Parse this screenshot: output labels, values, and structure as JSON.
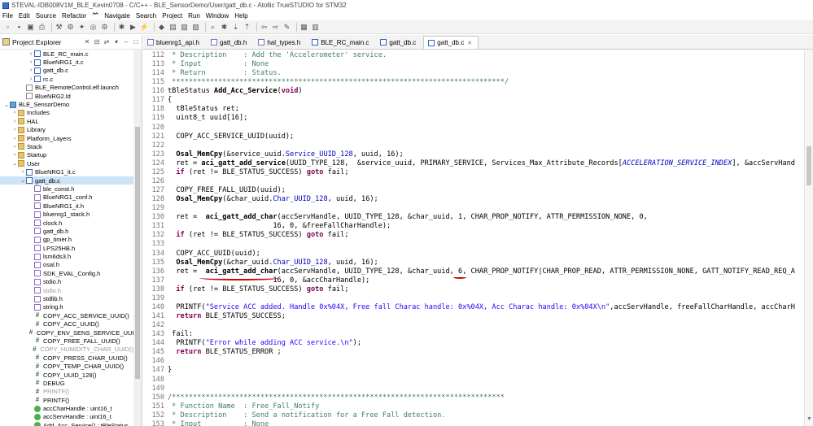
{
  "window": {
    "title": "STEVAL-IDB008V1M_BLE_Kevin0708 - C/C++ - BLE_SensorDemo/User/gatt_db.c - Atollic TrueSTUDIO for STM32"
  },
  "menu": [
    "File",
    "Edit",
    "Source",
    "Refactor",
    "𥫗",
    "Navigate",
    "Search",
    "Project",
    "Run",
    "Window",
    "Help"
  ],
  "toolbar": {
    "icons": [
      "new-icon",
      "save-icon",
      "save-all-icon",
      "print-icon",
      "build-icon",
      "build-all-icon",
      "clean-icon",
      "target-icon",
      "config-icon",
      "debug-icon",
      "run-icon",
      "external-tools-icon",
      "new-class-icon",
      "new-folder-icon",
      "new-source-icon",
      "new-header-icon",
      "search-icon",
      "bug-icon",
      "next-annotation-icon",
      "prev-annotation-icon",
      "back-icon",
      "forward-icon",
      "pin-icon",
      "perspective-icon",
      "layout-icon"
    ]
  },
  "explorer": {
    "title": "Project Explorer",
    "items": [
      {
        "label": "BLE_RC_main.c",
        "indent": 3,
        "arrow": ">",
        "icon": "cfile"
      },
      {
        "label": "BlueNRG1_it.c",
        "indent": 3,
        "arrow": ">",
        "icon": "cfile"
      },
      {
        "label": "gatt_db.c",
        "indent": 3,
        "arrow": ">",
        "icon": "cfile"
      },
      {
        "label": "rc.c",
        "indent": 3,
        "arrow": ">",
        "icon": "cfile"
      },
      {
        "label": "BLE_RemoteControl.elf.launch",
        "indent": 2,
        "arrow": "",
        "icon": "file"
      },
      {
        "label": "BlueNRG2.ld",
        "indent": 2,
        "arrow": "",
        "icon": "file"
      },
      {
        "label": "BLE_SensorDemo",
        "indent": 0,
        "arrow": "v",
        "icon": "project"
      },
      {
        "label": "Includes",
        "indent": 1,
        "arrow": ">",
        "icon": "folder"
      },
      {
        "label": "HAL",
        "indent": 1,
        "arrow": ">",
        "icon": "folder"
      },
      {
        "label": "Library",
        "indent": 1,
        "arrow": ">",
        "icon": "folder"
      },
      {
        "label": "Platform_Layers",
        "indent": 1,
        "arrow": ">",
        "icon": "folder"
      },
      {
        "label": "Stack",
        "indent": 1,
        "arrow": ">",
        "icon": "folder"
      },
      {
        "label": "Startup",
        "indent": 1,
        "arrow": ">",
        "icon": "folder"
      },
      {
        "label": "User",
        "indent": 1,
        "arrow": "v",
        "icon": "folder"
      },
      {
        "label": "BlueNRG1_it.c",
        "indent": 2,
        "arrow": ">",
        "icon": "cfile"
      },
      {
        "label": "gatt_db.c",
        "indent": 2,
        "arrow": "v",
        "icon": "cfile",
        "selected": true
      },
      {
        "label": "ble_const.h",
        "indent": 3,
        "arrow": "",
        "icon": "hfile"
      },
      {
        "label": "BlueNRG1_conf.h",
        "indent": 3,
        "arrow": "",
        "icon": "hfile"
      },
      {
        "label": "BlueNRG1_it.h",
        "indent": 3,
        "arrow": "",
        "icon": "hfile"
      },
      {
        "label": "bluenrg1_stack.h",
        "indent": 3,
        "arrow": "",
        "icon": "hfile"
      },
      {
        "label": "clock.h",
        "indent": 3,
        "arrow": "",
        "icon": "hfile"
      },
      {
        "label": "gatt_db.h",
        "indent": 3,
        "arrow": "",
        "icon": "hfile"
      },
      {
        "label": "gp_timer.h",
        "indent": 3,
        "arrow": "",
        "icon": "hfile"
      },
      {
        "label": "LPS25HB.h",
        "indent": 3,
        "arrow": "",
        "icon": "hfile"
      },
      {
        "label": "lsm6ds3.h",
        "indent": 3,
        "arrow": "",
        "icon": "hfile"
      },
      {
        "label": "osal.h",
        "indent": 3,
        "arrow": "",
        "icon": "hfile"
      },
      {
        "label": "SDK_EVAL_Config.h",
        "indent": 3,
        "arrow": "",
        "icon": "hfile"
      },
      {
        "label": "stdio.h",
        "indent": 3,
        "arrow": "",
        "icon": "hfile"
      },
      {
        "label": "stdio.h",
        "indent": 3,
        "arrow": "",
        "icon": "hfile",
        "gray": true
      },
      {
        "label": "stdlib.h",
        "indent": 3,
        "arrow": "",
        "icon": "hfile"
      },
      {
        "label": "string.h",
        "indent": 3,
        "arrow": "",
        "icon": "hfile"
      },
      {
        "label": "COPY_ACC_SERVICE_UUID()",
        "indent": 3,
        "arrow": "",
        "icon": "hash"
      },
      {
        "label": "COPY_ACC_UUID()",
        "indent": 3,
        "arrow": "",
        "icon": "hash"
      },
      {
        "label": "COPY_ENV_SENS_SERVICE_UUID()",
        "indent": 3,
        "arrow": "",
        "icon": "hash"
      },
      {
        "label": "COPY_FREE_FALL_UUID()",
        "indent": 3,
        "arrow": "",
        "icon": "hash"
      },
      {
        "label": "COPY_HUMIDITY_CHAR_UUID()",
        "indent": 3,
        "arrow": "",
        "icon": "hash",
        "gray": true
      },
      {
        "label": "COPY_PRESS_CHAR_UUID()",
        "indent": 3,
        "arrow": "",
        "icon": "hash"
      },
      {
        "label": "COPY_TEMP_CHAR_UUID()",
        "indent": 3,
        "arrow": "",
        "icon": "hash"
      },
      {
        "label": "COPY_UUID_128()",
        "indent": 3,
        "arrow": "",
        "icon": "hash"
      },
      {
        "label": "DEBUG",
        "indent": 3,
        "arrow": "",
        "icon": "hash"
      },
      {
        "label": "PRINTF()",
        "indent": 3,
        "arrow": "",
        "icon": "hash",
        "gray": true
      },
      {
        "label": "PRINTF()",
        "indent": 3,
        "arrow": "",
        "icon": "hash"
      },
      {
        "label": "accCharHandle : uint16_t",
        "indent": 3,
        "arrow": "",
        "icon": "func"
      },
      {
        "label": "accServHandle : uint16_t",
        "indent": 3,
        "arrow": "",
        "icon": "func"
      },
      {
        "label": "Add_Acc_Service() : tBleStatus",
        "indent": 3,
        "arrow": "",
        "icon": "func"
      }
    ]
  },
  "tabs": [
    {
      "label": "bluenrg1_api.h",
      "kind": "h"
    },
    {
      "label": "gatt_db.h",
      "kind": "h"
    },
    {
      "label": "hal_types.h",
      "kind": "h"
    },
    {
      "label": "BLE_RC_main.c",
      "kind": "c"
    },
    {
      "label": "gatt_db.c",
      "kind": "c"
    },
    {
      "label": "gatt_db.c",
      "kind": "c",
      "active": true
    }
  ],
  "editor": {
    "lines": [
      {
        "n": "112",
        "segs": [
          [
            " * Description    : Add the 'Accelerometer' service.",
            "cmt"
          ]
        ]
      },
      {
        "n": "113",
        "segs": [
          [
            " * Input          : None",
            "cmt"
          ]
        ]
      },
      {
        "n": "114",
        "segs": [
          [
            " * Return         : Status.",
            "cmt"
          ]
        ]
      },
      {
        "n": "115",
        "segs": [
          [
            " *******************************************************************************/",
            "cmt"
          ]
        ]
      },
      {
        "n": "116",
        "segs": [
          [
            "tBleStatus ",
            ""
          ],
          [
            "Add_Acc_Service",
            "fn"
          ],
          [
            "(",
            ""
          ],
          [
            "void",
            "kw"
          ],
          [
            ")",
            ""
          ]
        ]
      },
      {
        "n": "117",
        "segs": [
          [
            "{",
            ""
          ]
        ]
      },
      {
        "n": "118",
        "segs": [
          [
            "  tBleStatus ret;",
            ""
          ]
        ]
      },
      {
        "n": "119",
        "segs": [
          [
            "  uint8_t uuid[16];",
            ""
          ]
        ]
      },
      {
        "n": "120",
        "segs": [
          [
            "",
            ""
          ]
        ]
      },
      {
        "n": "121",
        "segs": [
          [
            "  COPY_ACC_SERVICE_UUID(uuid);",
            ""
          ]
        ]
      },
      {
        "n": "122",
        "segs": [
          [
            "",
            ""
          ]
        ]
      },
      {
        "n": "123",
        "segs": [
          [
            "  ",
            ""
          ],
          [
            "Osal_MemCpy",
            "fn"
          ],
          [
            "(&service_uuid.",
            ""
          ],
          [
            "Service_UUID_128",
            "fld"
          ],
          [
            ", uuid, 16);",
            ""
          ]
        ]
      },
      {
        "n": "124",
        "segs": [
          [
            "  ret = ",
            ""
          ],
          [
            "aci_gatt_add_service",
            "fn"
          ],
          [
            "(UUID_TYPE_128,  &service_uuid, PRIMARY_SERVICE, Services_Max_Attribute_Records[",
            ""
          ],
          [
            "ACCELERATION_SERVICE_INDEX",
            "macro-i"
          ],
          [
            "], &accServHand",
            ""
          ]
        ]
      },
      {
        "n": "125",
        "segs": [
          [
            "  ",
            ""
          ],
          [
            "if",
            "kw"
          ],
          [
            " (ret != BLE_STATUS_SUCCESS) ",
            ""
          ],
          [
            "goto",
            "kw"
          ],
          [
            " fail;",
            ""
          ]
        ]
      },
      {
        "n": "126",
        "segs": [
          [
            "",
            ""
          ]
        ]
      },
      {
        "n": "127",
        "segs": [
          [
            "  COPY_FREE_FALL_UUID(uuid);",
            ""
          ]
        ]
      },
      {
        "n": "128",
        "segs": [
          [
            "  ",
            ""
          ],
          [
            "Osal_MemCpy",
            "fn"
          ],
          [
            "(&char_uuid.",
            ""
          ],
          [
            "Char_UUID_128",
            "fld"
          ],
          [
            ", uuid, 16);",
            ""
          ]
        ]
      },
      {
        "n": "129",
        "segs": [
          [
            "",
            ""
          ]
        ]
      },
      {
        "n": "130",
        "segs": [
          [
            "  ret =  ",
            ""
          ],
          [
            "aci_gatt_add_char",
            "fn"
          ],
          [
            "(accServHandle, UUID_TYPE_128, &char_uuid, 1, CHAR_PROP_NOTIFY, ATTR_PERMISSION_NONE, 0,",
            ""
          ]
        ]
      },
      {
        "n": "131",
        "segs": [
          [
            "                         16, 0, &freeFallCharHandle);",
            ""
          ]
        ]
      },
      {
        "n": "132",
        "segs": [
          [
            "  ",
            ""
          ],
          [
            "if",
            "kw"
          ],
          [
            " (ret != BLE_STATUS_SUCCESS) ",
            ""
          ],
          [
            "goto",
            "kw"
          ],
          [
            " fail;",
            ""
          ]
        ]
      },
      {
        "n": "133",
        "segs": [
          [
            "",
            ""
          ]
        ]
      },
      {
        "n": "134",
        "segs": [
          [
            "  COPY_ACC_UUID(uuid);",
            ""
          ]
        ]
      },
      {
        "n": "135",
        "segs": [
          [
            "  ",
            ""
          ],
          [
            "Osal_MemCpy",
            "fn"
          ],
          [
            "(&char_uuid.",
            ""
          ],
          [
            "Char_UUID_128",
            "fld"
          ],
          [
            ", uuid, 16);",
            ""
          ]
        ]
      },
      {
        "n": "136",
        "segs": [
          [
            "  ret =  ",
            ""
          ],
          [
            "aci_gatt_add_char",
            "fn"
          ],
          [
            "(accServHandle, UUID_TYPE_128, &char_uuid, 6, CHAR_PROP_NOTIFY|CHAR_PROP_READ, ATTR_PERMISSION_NONE, GATT_NOTIFY_READ_REQ_A",
            ""
          ]
        ]
      },
      {
        "n": "137",
        "segs": [
          [
            "                         16, 0, &accCharHandle);",
            ""
          ]
        ]
      },
      {
        "n": "138",
        "segs": [
          [
            "  ",
            ""
          ],
          [
            "if",
            "kw"
          ],
          [
            " (ret != BLE_STATUS_SUCCESS) ",
            ""
          ],
          [
            "goto",
            "kw"
          ],
          [
            " fail;",
            ""
          ]
        ]
      },
      {
        "n": "139",
        "segs": [
          [
            "",
            ""
          ]
        ]
      },
      {
        "n": "140",
        "segs": [
          [
            "  PRINTF(",
            ""
          ],
          [
            "\"Service ACC added. Handle 0x%04X, Free fall Charac handle: 0x%04X, Acc Charac handle: 0x%04X\\n\"",
            "str"
          ],
          [
            ",accServHandle, freeFallCharHandle, accCharH",
            ""
          ]
        ]
      },
      {
        "n": "141",
        "segs": [
          [
            "  ",
            ""
          ],
          [
            "return",
            "kw"
          ],
          [
            " BLE_STATUS_SUCCESS;",
            ""
          ]
        ]
      },
      {
        "n": "142",
        "segs": [
          [
            "",
            ""
          ]
        ]
      },
      {
        "n": "143",
        "segs": [
          [
            " fail:",
            ""
          ]
        ]
      },
      {
        "n": "144",
        "segs": [
          [
            "  PRINTF(",
            ""
          ],
          [
            "\"Error while adding ACC service.\\n\"",
            "str"
          ],
          [
            ");",
            ""
          ]
        ]
      },
      {
        "n": "145",
        "segs": [
          [
            "  ",
            ""
          ],
          [
            "return",
            "kw"
          ],
          [
            " BLE_STATUS_ERROR ;",
            ""
          ]
        ]
      },
      {
        "n": "146",
        "segs": [
          [
            "",
            ""
          ]
        ]
      },
      {
        "n": "147",
        "segs": [
          [
            "}",
            ""
          ]
        ]
      },
      {
        "n": "148",
        "segs": [
          [
            "",
            ""
          ]
        ]
      },
      {
        "n": "149",
        "segs": [
          [
            "",
            ""
          ]
        ]
      },
      {
        "n": "150",
        "segs": [
          [
            "/*******************************************************************************",
            "cmt"
          ]
        ]
      },
      {
        "n": "151",
        "segs": [
          [
            " * Function Name  : Free_Fall_Notify",
            "cmt"
          ]
        ]
      },
      {
        "n": "152",
        "segs": [
          [
            " * Description    : Send a notification for a Free Fall detection.",
            "cmt"
          ]
        ]
      },
      {
        "n": "153",
        "segs": [
          [
            " * Input          : None",
            "cmt"
          ]
        ]
      },
      {
        "n": "154",
        "segs": [
          [
            " * Return         : Status.",
            "cmt"
          ]
        ]
      }
    ]
  },
  "colors": {
    "comment": "#3f7f5f",
    "keyword": "#7f0055",
    "string": "#2a00ff",
    "field": "#0000c0",
    "annotation": "#d80000",
    "selection": "#cce4f7"
  }
}
